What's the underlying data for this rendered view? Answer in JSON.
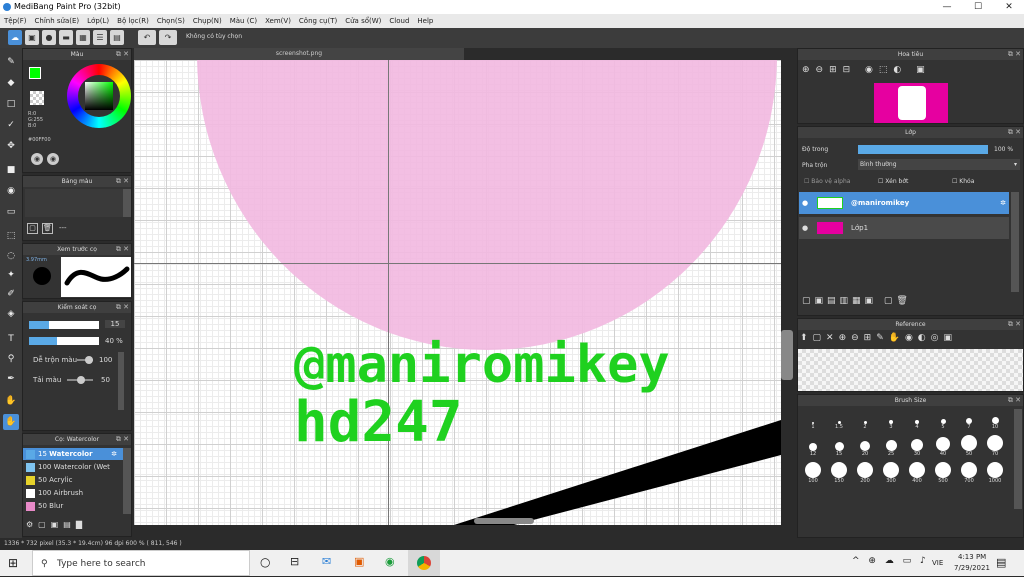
{
  "app": {
    "title": "MediBang Paint Pro (32bit)",
    "min": "—",
    "max": "☐",
    "close": "✕"
  },
  "menu": [
    "Tệp(F)",
    "Chỉnh sửa(E)",
    "Lớp(L)",
    "Bộ lọc(R)",
    "Chọn(S)",
    "Chụp(N)",
    "Màu (C)",
    "Xem(V)",
    "Công cụ(T)",
    "Cửa sổ(W)",
    "Cloud",
    "Help"
  ],
  "toolbar": {
    "hint": "Không có tùy chọn"
  },
  "canvas": {
    "tab": "screenshot.png",
    "text1": "@maniromikey",
    "text2": "hd247"
  },
  "color": {
    "title": "Màu",
    "values": "R:0\nG:255\nB:0",
    "hex": "#00FF00"
  },
  "palette": {
    "title": "Bảng màu",
    "dash": "---"
  },
  "brush_preview": {
    "title": "Xem trước cọ",
    "size": "3.97mm"
  },
  "brush_control": {
    "title": "Kiểm soát cọ",
    "size_value": "15",
    "opacity_value": "40 %",
    "blend_label": "Dễ trộn màu",
    "blend_value": "100",
    "load_label": "Tải màu",
    "load_value": "50"
  },
  "brushes": {
    "title": "Cọ: Watercolor",
    "items": [
      {
        "val": "15",
        "name": "Watercolor",
        "color": "#5aa9e6",
        "sel": true
      },
      {
        "val": "100",
        "name": "Watercolor (Wet",
        "color": "#7fc4f0",
        "sel": false
      },
      {
        "val": "50",
        "name": "Acrylic",
        "color": "#e6d22a",
        "sel": false
      },
      {
        "val": "100",
        "name": "Airbrush",
        "color": "#ffffff",
        "sel": false
      },
      {
        "val": "50",
        "name": "Blur",
        "color": "#e88ac8",
        "sel": false
      }
    ]
  },
  "navigator": {
    "title": "Hoa tiêu"
  },
  "layer": {
    "title": "Lớp",
    "opacity_label": "Độ trong",
    "opacity_value": "100 %",
    "blend_label": "Pha trộn",
    "blend_value": "Bình thường",
    "alpha": "Bảo vệ alpha",
    "clip": "Xén bớt",
    "lock": "Khóa",
    "items": [
      {
        "name": "@maniromikey",
        "sel": true
      },
      {
        "name": "Lớp1",
        "sel": false
      }
    ]
  },
  "reference": {
    "title": "Reference"
  },
  "brush_size": {
    "title": "Brush Size",
    "sizes": [
      "1",
      "1.5",
      "2",
      "3",
      "4",
      "5",
      "7",
      "10",
      "12",
      "15",
      "20",
      "25",
      "30",
      "40",
      "50",
      "70",
      "100",
      "150",
      "200",
      "300",
      "400",
      "500",
      "700",
      "1000"
    ]
  },
  "status": {
    "text": "1336 * 732 pixel  (35.3 * 19.4cm)  96 dpi  600 %  ( 811, 546 )"
  },
  "taskbar": {
    "search": "Type here to search",
    "time": "4:13 PM",
    "date": "7/29/2021",
    "lang": "VIE"
  },
  "colors": {
    "accent": "#4a90d9",
    "green": "#1fd11f",
    "pink": "#f2b8e0"
  }
}
